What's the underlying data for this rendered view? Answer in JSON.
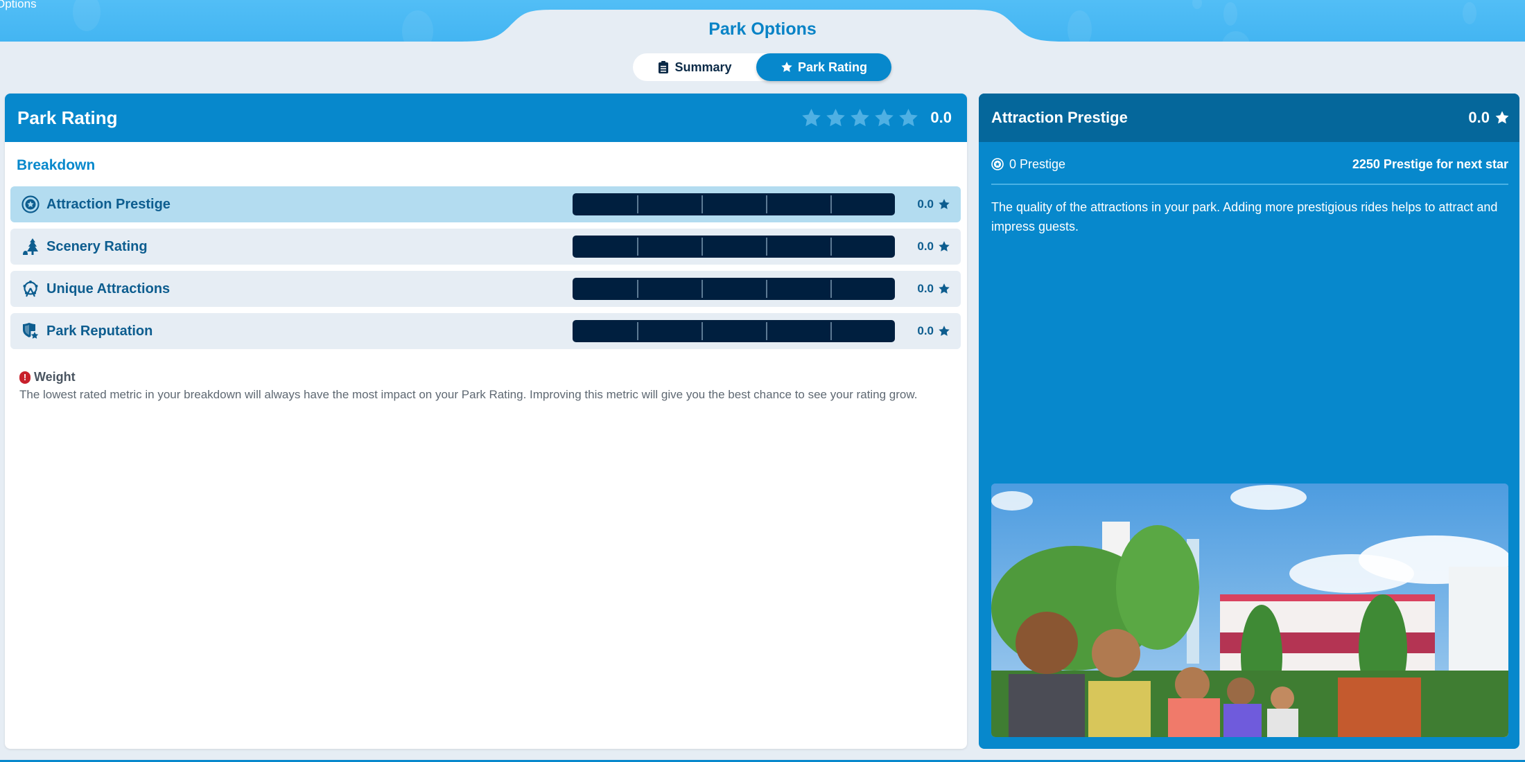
{
  "window": {
    "corner_label": "Options",
    "title": "Park Options"
  },
  "tabs": [
    {
      "label": "Summary",
      "icon": "clipboard-icon",
      "active": false
    },
    {
      "label": "Park Rating",
      "icon": "star-icon",
      "active": true
    }
  ],
  "park_rating": {
    "title": "Park Rating",
    "stars_total": 5,
    "stars_filled": 0,
    "value": "0.0",
    "breakdown_title": "Breakdown",
    "metrics": [
      {
        "label": "Attraction Prestige",
        "icon": "prestige-badge-icon",
        "value": "0.0",
        "progress": 0,
        "selected": true
      },
      {
        "label": "Scenery Rating",
        "icon": "tree-icon",
        "value": "0.0",
        "progress": 0,
        "selected": false
      },
      {
        "label": "Unique Attractions",
        "icon": "ferris-wheel-icon",
        "value": "0.0",
        "progress": 0,
        "selected": false
      },
      {
        "label": "Park Reputation",
        "icon": "reputation-shield-icon",
        "value": "0.0",
        "progress": 0,
        "selected": false
      }
    ],
    "weight": {
      "title": "Weight",
      "text": "The lowest rated metric in your breakdown will always have the most impact on your Park Rating. Improving this metric will give you the best chance to see your rating grow."
    }
  },
  "detail": {
    "title": "Attraction Prestige",
    "score": "0.0",
    "current_prestige": "0 Prestige",
    "next_star": "2250 Prestige for next star",
    "description": "The quality of the attractions in your park. Adding more prestigious rides helps to attract and impress guests.",
    "image_alt": "Park guests in front of attractions"
  },
  "colors": {
    "accent": "#0788cc",
    "header_dark": "#05679b",
    "bar_track": "#001f3f",
    "label_text": "#0d5d8f",
    "warning": "#c8202b",
    "selected_row": "#b3dcf0"
  }
}
